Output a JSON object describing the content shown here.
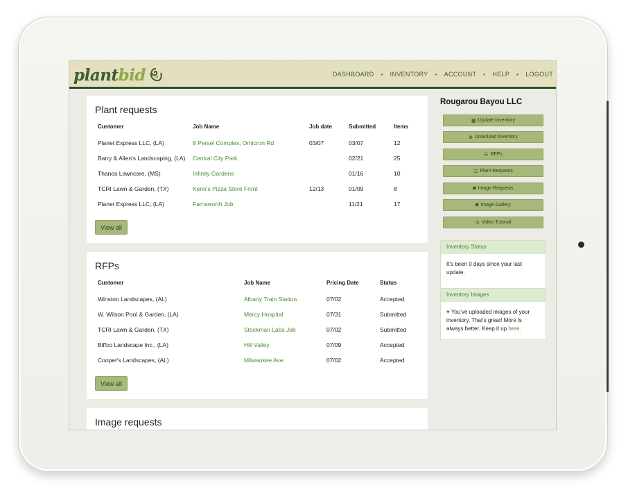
{
  "header": {
    "logo_plant": "plant",
    "logo_bid": "bid",
    "nav": [
      "DASHBOARD",
      "INVENTORY",
      "ACCOUNT",
      "HELP",
      "LOGOUT"
    ],
    "nav_separator": "•"
  },
  "plant_requests": {
    "title": "Plant requests",
    "columns": [
      "Customer",
      "Job Name",
      "Job date",
      "Submitted",
      "Items"
    ],
    "rows": [
      {
        "customer": "Planet Express LLC, (LA)",
        "job": "8 Persei Complex, Omicron Rd",
        "job_date": "03/07",
        "submitted": "03/07",
        "items": "12"
      },
      {
        "customer": "Barry & Allen's Landscaping, (LA)",
        "job": "Central City Park",
        "job_date": "",
        "submitted": "02/21",
        "items": "25"
      },
      {
        "customer": "Thanos Lawncare, (MS)",
        "job": "Infinity Gardens",
        "job_date": "",
        "submitted": "01/16",
        "items": "10"
      },
      {
        "customer": "TCRI Lawn & Garden, (TX)",
        "job": "Keno's Pizza Store Front",
        "job_date": "12/13",
        "submitted": "01/09",
        "items": "8"
      },
      {
        "customer": "Planet Express LLC, (LA)",
        "job": "Farnsworth Job",
        "job_date": "",
        "submitted": "11/21",
        "items": "17"
      }
    ],
    "view_all": "View all"
  },
  "rfps": {
    "title": "RFPs",
    "columns": [
      "Customer",
      "Job Name",
      "Pricing Date",
      "Status"
    ],
    "rows": [
      {
        "customer": "Winston Landscapes, (AL)",
        "job": "Albany Train Station",
        "date": "07/02",
        "status": "Accepted"
      },
      {
        "customer": "W. Wilson Pool & Garden, (LA)",
        "job": "Mercy Hospital",
        "date": "07/31",
        "status": "Submitted"
      },
      {
        "customer": "TCRI Lawn & Garden, (TX)",
        "job": "Stockman Labs Job",
        "date": "07/02",
        "status": "Submitted"
      },
      {
        "customer": "Biffco Landscape Inc., (LA)",
        "job": "Hill Valley",
        "date": "07/09",
        "status": "Accepted"
      },
      {
        "customer": "Cooper's Landscapes, (AL)",
        "job": "Milwaukee Ave.",
        "date": "07/02",
        "status": "Accepted"
      }
    ],
    "view_all": "View all"
  },
  "image_requests": {
    "title": "Image requests"
  },
  "sidebar": {
    "company": "Rougarou Bayou LLC",
    "buttons": [
      {
        "label": "Update Inventory",
        "icon": "table-icon",
        "glyph": "▦"
      },
      {
        "label": "Download Inventory",
        "icon": "download-circle-icon",
        "glyph": "⊕"
      },
      {
        "label": "RFPs",
        "icon": "list-icon",
        "glyph": "☷"
      },
      {
        "label": "Plant Requests",
        "icon": "list-icon",
        "glyph": "☷"
      },
      {
        "label": "Image Requests",
        "icon": "camera-icon",
        "glyph": "◙"
      },
      {
        "label": "Image Gallery",
        "icon": "camera-icon",
        "glyph": "◙"
      },
      {
        "label": "Video Tutorial",
        "icon": "play-circle-icon",
        "glyph": "⊙"
      }
    ],
    "inventory_status": {
      "title": "Inventory Status",
      "text": "It's been 0 days since your last update."
    },
    "inventory_images": {
      "title": "Inventory Images",
      "heart": "♥",
      "text": "You've uploaded images of your inventory. That's great! More is always better. Keep it up",
      "link": "here."
    }
  },
  "colors": {
    "header_bg": "#e4dfbe",
    "brand_dark": "#3d5e2e",
    "brand_light": "#8ea94a",
    "link": "#4a8a2e",
    "button": "#a7b87a"
  }
}
